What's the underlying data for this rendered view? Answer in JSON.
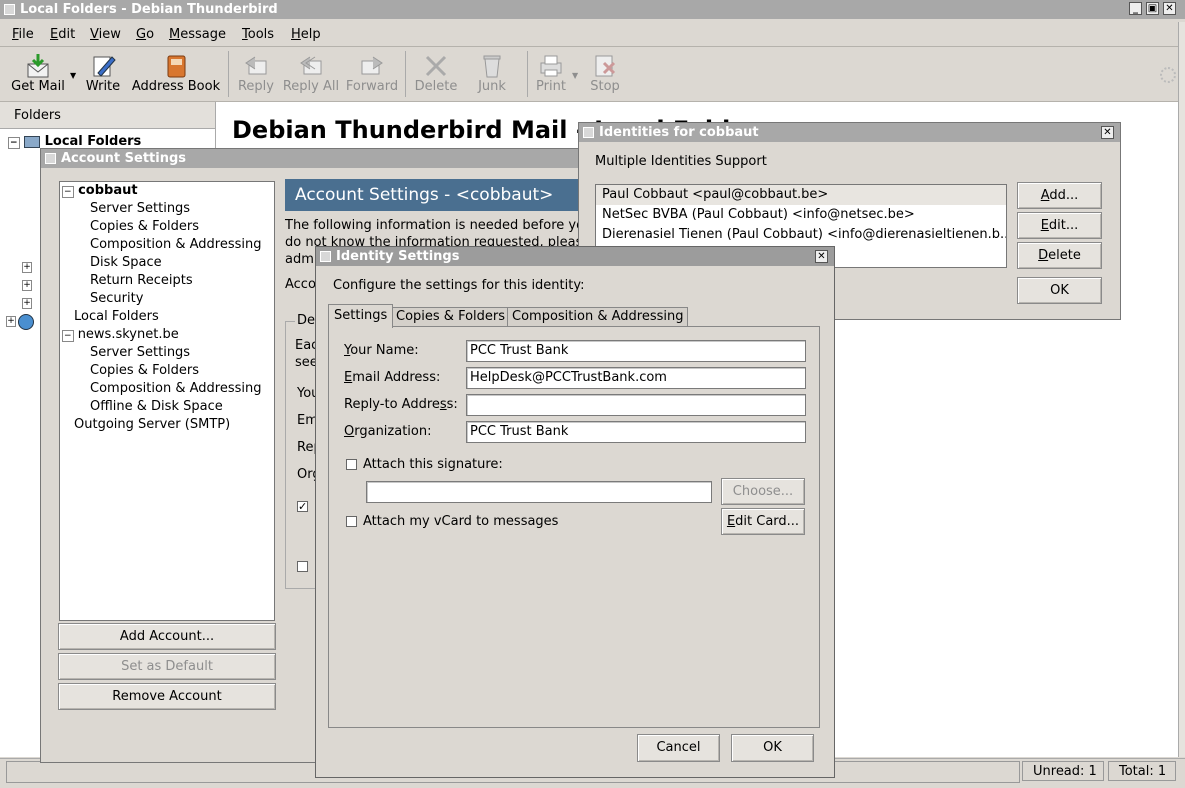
{
  "main_window": {
    "title": "Local Folders - Debian Thunderbird",
    "menu": [
      "File",
      "Edit",
      "View",
      "Go",
      "Message",
      "Tools",
      "Help"
    ],
    "toolbar": [
      {
        "label": "Get Mail",
        "icon": "get-mail-icon",
        "enabled": true
      },
      {
        "label": "Write",
        "icon": "write-icon",
        "enabled": true
      },
      {
        "label": "Address Book",
        "icon": "address-book-icon",
        "enabled": true
      },
      {
        "label": "Reply",
        "icon": "reply-icon",
        "enabled": false
      },
      {
        "label": "Reply All",
        "icon": "reply-all-icon",
        "enabled": false
      },
      {
        "label": "Forward",
        "icon": "forward-icon",
        "enabled": false
      },
      {
        "label": "Delete",
        "icon": "delete-icon",
        "enabled": false
      },
      {
        "label": "Junk",
        "icon": "junk-icon",
        "enabled": false
      },
      {
        "label": "Print",
        "icon": "print-icon",
        "enabled": false
      },
      {
        "label": "Stop",
        "icon": "stop-icon",
        "enabled": false
      }
    ],
    "folders_header": "Folders",
    "folder_root": "Local Folders",
    "heading": "Debian Thunderbird Mail - Local Folders",
    "status": {
      "unread": "Unread: 1",
      "total": "Total: 1"
    }
  },
  "account_settings": {
    "title": "Account Settings",
    "tree": [
      {
        "label": "cobbaut",
        "level": 0,
        "bold": true
      },
      {
        "label": "Server Settings",
        "level": 1
      },
      {
        "label": "Copies & Folders",
        "level": 1
      },
      {
        "label": "Composition & Addressing",
        "level": 1
      },
      {
        "label": "Disk Space",
        "level": 1
      },
      {
        "label": "Return Receipts",
        "level": 1
      },
      {
        "label": "Security",
        "level": 1
      },
      {
        "label": "Local Folders",
        "level": 0
      },
      {
        "label": "news.skynet.be",
        "level": 0
      },
      {
        "label": "Server Settings",
        "level": 1
      },
      {
        "label": "Copies & Folders",
        "level": 1
      },
      {
        "label": "Composition & Addressing",
        "level": 1
      },
      {
        "label": "Offline & Disk Space",
        "level": 1
      },
      {
        "label": "Outgoing Server (SMTP)",
        "level": 0
      }
    ],
    "banner": "Account Settings - <cobbaut>",
    "intro_line1": "The following information is needed before you",
    "intro_line2": "do not know the information requested, please",
    "intro_line3": "adm",
    "acct_label": "Acco",
    "group_label": "Def",
    "group_line1": "Eac",
    "group_line2": "see",
    "row_labels": [
      "You",
      "Em",
      "Rep",
      "Org"
    ],
    "add_account": "Add Account...",
    "set_default": "Set as Default",
    "remove_account": "Remove Account"
  },
  "identities": {
    "title": "Identities for cobbaut",
    "heading": "Multiple Identities Support",
    "list": [
      "Paul Cobbaut <paul@cobbaut.be>",
      "NetSec BVBA (Paul Cobbaut) <info@netsec.be>",
      "Dierenasiel Tienen (Paul Cobbaut) <info@dierenasieltienen.b..."
    ],
    "add": "Add...",
    "edit": "Edit...",
    "delete": "Delete",
    "ok": "OK"
  },
  "identity_settings": {
    "title": "Identity Settings",
    "prompt": "Configure the settings for this identity:",
    "tabs": [
      "Settings",
      "Copies & Folders",
      "Composition & Addressing"
    ],
    "your_name_label": "Your Name:",
    "your_name": "PCC Trust Bank",
    "email_label": "Email Address:",
    "email": "HelpDesk@PCCTrustBank.com",
    "reply_to_label": "Reply-to Address:",
    "reply_to": "",
    "org_label": "Organization:",
    "org": "PCC Trust Bank",
    "attach_sig": "Attach this signature:",
    "choose": "Choose...",
    "attach_vcard": "Attach my vCard to messages",
    "edit_card": "Edit Card...",
    "cancel": "Cancel",
    "ok": "OK"
  }
}
